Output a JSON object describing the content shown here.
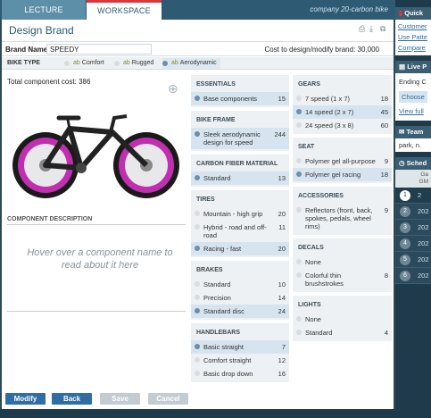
{
  "tabs": {
    "lecture": "LECTURE",
    "workspace": "WORKSPACE"
  },
  "company": "company 20-carbon bike",
  "title": "Design Brand",
  "brand": {
    "label": "Brand Name",
    "value": "SPEEDY",
    "cost_text": "Cost to design/modify brand: 30,000"
  },
  "bike_type": {
    "label": "BIKE TYPE",
    "options": [
      {
        "label": "Comfort"
      },
      {
        "label": "Rugged"
      },
      {
        "label": "Aerodynamic"
      }
    ],
    "selected": "Aerodynamic"
  },
  "total_cost": "Total component cost: 386",
  "description": {
    "heading": "COMPONENT DESCRIPTION",
    "placeholder": "Hover over a component name to read about it here"
  },
  "groups": {
    "essentials": {
      "title": "ESSENTIALS",
      "options": [
        {
          "label": "Base components",
          "cost": "15"
        }
      ]
    },
    "bike_frame": {
      "title": "BIKE FRAME",
      "options": [
        {
          "label": "Sleek aerodynamic design for speed",
          "cost": "244"
        }
      ]
    },
    "carbon_fiber": {
      "title": "CARBON FIBER MATERIAL",
      "options": [
        {
          "label": "Standard",
          "cost": "13"
        }
      ]
    },
    "tires": {
      "title": "TIRES",
      "options": [
        {
          "label": "Mountain - high grip",
          "cost": "20"
        },
        {
          "label": "Hybrid - road and off-road",
          "cost": "11"
        },
        {
          "label": "Racing - fast",
          "cost": "20"
        }
      ]
    },
    "brakes": {
      "title": "BRAKES",
      "options": [
        {
          "label": "Standard",
          "cost": "10"
        },
        {
          "label": "Precision",
          "cost": "14"
        },
        {
          "label": "Standard disc",
          "cost": "24"
        }
      ]
    },
    "handlebars": {
      "title": "HANDLEBARS",
      "options": [
        {
          "label": "Basic straight",
          "cost": "7"
        },
        {
          "label": "Comfort straight",
          "cost": "12"
        },
        {
          "label": "Basic drop down",
          "cost": "16"
        }
      ]
    },
    "gears": {
      "title": "GEARS",
      "options": [
        {
          "label": "7 speed (1 x 7)",
          "cost": "18"
        },
        {
          "label": "14 speed (2 x 7)",
          "cost": "45"
        },
        {
          "label": "24 speed (3 x 8)",
          "cost": "60"
        }
      ]
    },
    "seat": {
      "title": "SEAT",
      "options": [
        {
          "label": "Polymer gel all-purpose",
          "cost": "9"
        },
        {
          "label": "Polymer gel racing",
          "cost": "18"
        }
      ]
    },
    "accessories": {
      "title": "ACCESSORIES",
      "options": [
        {
          "label": "Reflectors (front, back, spokes, pedals, wheel rims)",
          "cost": "9"
        }
      ]
    },
    "decals": {
      "title": "DECALS",
      "options": [
        {
          "label": "None",
          "cost": ""
        },
        {
          "label": "Colorful thin brushstrokes",
          "cost": "8"
        }
      ]
    },
    "lights": {
      "title": "LIGHTS",
      "options": [
        {
          "label": "None",
          "cost": ""
        },
        {
          "label": "Standard",
          "cost": "4"
        }
      ]
    }
  },
  "buttons": {
    "modify": "Modify",
    "back": "Back",
    "save": "Save",
    "cancel": "Cancel"
  },
  "sidebar": {
    "quick_title": "Quick",
    "quick_links": [
      "Customer",
      "Use Patte",
      "Compare"
    ],
    "live_title": "Live P",
    "live_text": "Ending C",
    "live_button": "Choose",
    "live_link": "View full",
    "team_title": "Team",
    "team_text": "park, n.",
    "sched_title": "Sched",
    "sched_col_a": "Ga",
    "sched_col_b": "GM",
    "sched_rows": [
      {
        "num": "1",
        "year": "2"
      },
      {
        "num": "2",
        "year": "202"
      },
      {
        "num": "3",
        "year": "202"
      },
      {
        "num": "4",
        "year": "202"
      },
      {
        "num": "5",
        "year": "202"
      },
      {
        "num": "6",
        "year": "202"
      }
    ]
  },
  "colors": {
    "accent": "#2e5a73",
    "button": "#2f6da3",
    "selected": "#d6e4ef",
    "tab_marker": "#d9363e",
    "wheel_rim": "#c02fb0"
  }
}
